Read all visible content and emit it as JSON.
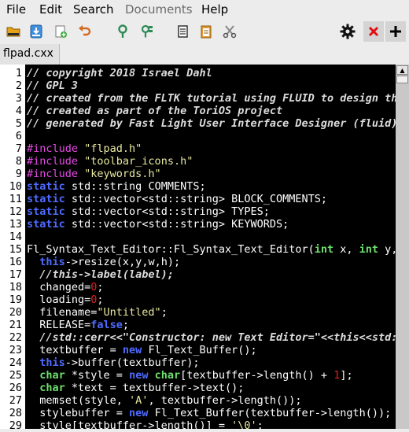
{
  "menubar": {
    "file": "File",
    "edit": "Edit",
    "search": "Search",
    "documents": "Documents",
    "help": "Help"
  },
  "toolbar": {
    "icons": [
      "open-folder-icon",
      "save-icon",
      "new-file-icon",
      "undo-icon",
      "find-icon",
      "replace-icon",
      "copy-icon",
      "paste-icon",
      "cut-icon",
      "gear-icon",
      "close-icon",
      "add-icon"
    ]
  },
  "tab": {
    "label": "flpad.cxx"
  },
  "editor": {
    "line_numbers": [
      "1",
      "2",
      "3",
      "4",
      "5",
      "6",
      "7",
      "8",
      "9",
      "10",
      "11",
      "12",
      "13",
      "14",
      "15",
      "16",
      "17",
      "18",
      "19",
      "20",
      "21",
      "22",
      "23",
      "24",
      "25",
      "26",
      "27",
      "28",
      "29"
    ],
    "lines": [
      [
        {
          "t": "// copyright 2018 Israel Dahl",
          "c": "cm"
        }
      ],
      [
        {
          "t": "// GPL 3",
          "c": "cm"
        }
      ],
      [
        {
          "t": "// created from the FLTK tutorial using FLUID to design th",
          "c": "cm"
        }
      ],
      [
        {
          "t": "// created as part of the ToriOS project",
          "c": "cm"
        }
      ],
      [
        {
          "t": "// generated by Fast Light User Interface Designer (fluid)",
          "c": "cm"
        }
      ],
      [],
      [
        {
          "t": "#include ",
          "c": "pp"
        },
        {
          "t": "\"flpad.h\"",
          "c": "st"
        }
      ],
      [
        {
          "t": "#include ",
          "c": "pp"
        },
        {
          "t": "\"toolbar_icons.h\"",
          "c": "st"
        }
      ],
      [
        {
          "t": "#include ",
          "c": "pp"
        },
        {
          "t": "\"keywords.h\"",
          "c": "st"
        }
      ],
      [
        {
          "t": "static",
          "c": "kw"
        },
        {
          "t": " std::string COMMENTS;",
          "c": ""
        }
      ],
      [
        {
          "t": "static",
          "c": "kw"
        },
        {
          "t": " std::vector<std::string> BLOCK_COMMENTS;",
          "c": ""
        }
      ],
      [
        {
          "t": "static",
          "c": "kw"
        },
        {
          "t": " std::vector<std::string> TYPES;",
          "c": ""
        }
      ],
      [
        {
          "t": "static",
          "c": "kw"
        },
        {
          "t": " std::vector<std::string> KEYWORDS;",
          "c": ""
        }
      ],
      [],
      [
        {
          "t": "Fl_Syntax_Text_Editor::Fl_Syntax_Text_Editor(",
          "c": ""
        },
        {
          "t": "int",
          "c": "ty"
        },
        {
          "t": " x, ",
          "c": ""
        },
        {
          "t": "int",
          "c": "ty"
        },
        {
          "t": " y,",
          "c": ""
        }
      ],
      [
        {
          "t": "  ",
          "c": ""
        },
        {
          "t": "this",
          "c": "kw"
        },
        {
          "t": "->resize(x,y,w,h);",
          "c": ""
        }
      ],
      [
        {
          "t": "  //this->label(label);",
          "c": "cm"
        }
      ],
      [
        {
          "t": "  changed=",
          "c": ""
        },
        {
          "t": "0",
          "c": "nm"
        },
        {
          "t": ";",
          "c": ""
        }
      ],
      [
        {
          "t": "  loading=",
          "c": ""
        },
        {
          "t": "0",
          "c": "nm"
        },
        {
          "t": ";",
          "c": ""
        }
      ],
      [
        {
          "t": "  filename=",
          "c": ""
        },
        {
          "t": "\"Untitled\"",
          "c": "st"
        },
        {
          "t": ";",
          "c": ""
        }
      ],
      [
        {
          "t": "  RELEASE=",
          "c": ""
        },
        {
          "t": "false",
          "c": "kw"
        },
        {
          "t": ";",
          "c": ""
        }
      ],
      [
        {
          "t": "  //std::cerr<<\"Constructor: new Text Editor=\"<<this<<std:",
          "c": "cm"
        }
      ],
      [
        {
          "t": "  textbuffer = ",
          "c": ""
        },
        {
          "t": "new",
          "c": "kw"
        },
        {
          "t": " Fl_Text_Buffer();",
          "c": ""
        }
      ],
      [
        {
          "t": "  ",
          "c": ""
        },
        {
          "t": "this",
          "c": "kw"
        },
        {
          "t": "->buffer(textbuffer);",
          "c": ""
        }
      ],
      [
        {
          "t": "  ",
          "c": ""
        },
        {
          "t": "char",
          "c": "ty"
        },
        {
          "t": " *style = ",
          "c": ""
        },
        {
          "t": "new",
          "c": "kw"
        },
        {
          "t": " ",
          "c": ""
        },
        {
          "t": "char",
          "c": "ty"
        },
        {
          "t": "[textbuffer->length() + ",
          "c": ""
        },
        {
          "t": "1",
          "c": "nm"
        },
        {
          "t": "];",
          "c": ""
        }
      ],
      [
        {
          "t": "  ",
          "c": ""
        },
        {
          "t": "char",
          "c": "ty"
        },
        {
          "t": " *text = textbuffer->text();",
          "c": ""
        }
      ],
      [
        {
          "t": "  memset(style, ",
          "c": ""
        },
        {
          "t": "'A'",
          "c": "st"
        },
        {
          "t": ", textbuffer->length());",
          "c": ""
        }
      ],
      [
        {
          "t": "  stylebuffer = ",
          "c": ""
        },
        {
          "t": "new",
          "c": "kw"
        },
        {
          "t": " Fl_Text_Buffer(textbuffer->length());",
          "c": ""
        }
      ],
      [
        {
          "t": "  style[textbuffer->length()] = ",
          "c": ""
        },
        {
          "t": "'\\0'",
          "c": "st"
        },
        {
          "t": ";",
          "c": ""
        }
      ]
    ]
  },
  "colors": {
    "background": "#000000",
    "comment": "#dcdcdc",
    "preprocessor": "#e64ae6",
    "string": "#e8e8a0",
    "keyword": "#4f6bff",
    "type": "#6ee06e",
    "number": "#e02020"
  }
}
